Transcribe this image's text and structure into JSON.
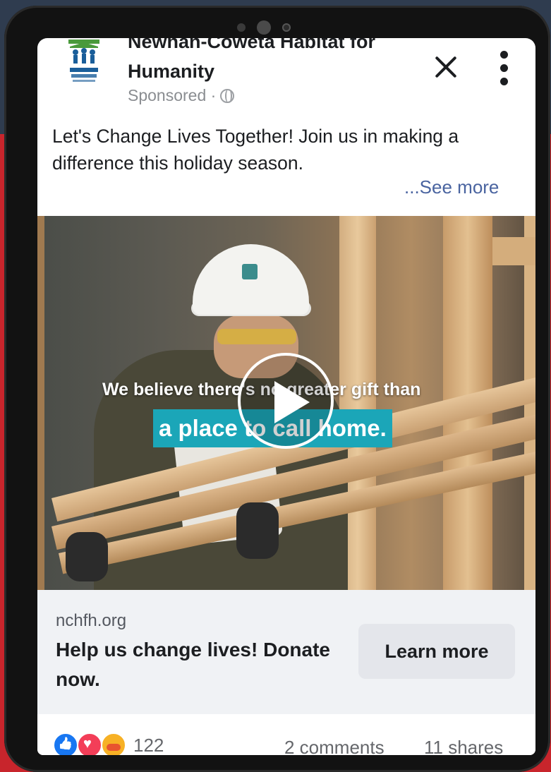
{
  "post": {
    "page_name": "Newnan-Coweta Habitat for Humanity",
    "sponsored_label": "Sponsored ·",
    "text": "Let's Change Lives Together! Join us in making a difference this holiday season.",
    "see_more": "...See more"
  },
  "video": {
    "caption_line1": "We believe there's no greater gift than",
    "caption_line2": "a place to call home.",
    "caption_highlight_color": "#1ba6b8"
  },
  "link_preview": {
    "domain": "nchfh.org",
    "title": "Help us change lives! Donate now.",
    "cta_label": "Learn more"
  },
  "engagement": {
    "reaction_icons": [
      "like-icon",
      "love-icon",
      "care-icon"
    ],
    "reaction_count": "122",
    "comments": "2 comments",
    "shares": "11 shares"
  },
  "colors": {
    "accent_link": "#4a64a0",
    "secondary_text": "#65676b",
    "background_red": "#c8252c"
  }
}
